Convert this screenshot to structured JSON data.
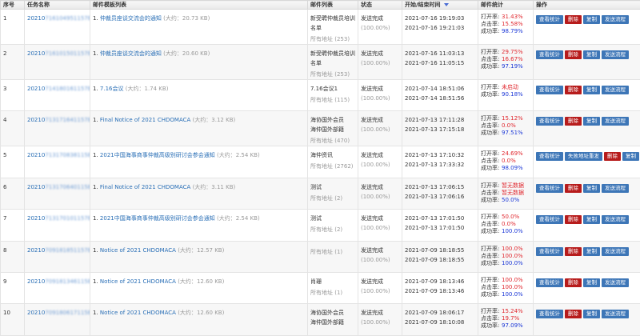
{
  "headers": {
    "seq": "序号",
    "task": "任务名称",
    "template": "邮件模板列表",
    "list": "邮件列表",
    "status": "状态",
    "time": "开始/结束时间",
    "stats": "邮件统计",
    "ops": "操作"
  },
  "labels": {
    "size_prefix": "(大约：",
    "size_suffix": ")",
    "open_rate": "打开率:",
    "click_rate": "点击率:",
    "success_rate": "成功率:",
    "all_addr": "所有地址",
    "btn_stats": "查看统计",
    "btn_delete": "删除",
    "btn_copy": "复制",
    "btn_flow": "发送流程",
    "btn_resend": "失败地址重发"
  },
  "rows": [
    {
      "seq": "1",
      "task_prefix": "20210",
      "task_tail": "716104951157B45",
      "tpl_no": "1.",
      "tpl_name": "仲裁员座谈交流会的通知",
      "size": "20.73 KB",
      "list_name": "新受聘仲裁员培训名单",
      "list_count": "(253)",
      "status": "发送完成",
      "status_pct": "(100.00%)",
      "start": "2021-07-16 19:19:03",
      "end": "2021-07-16 19:21:03",
      "open": "31.43%",
      "click": "15.58%",
      "success": "98.79%",
      "resend": false
    },
    {
      "seq": "2",
      "task_prefix": "20210",
      "task_tail": "716101501157B46",
      "tpl_no": "1.",
      "tpl_name": "仲裁员座谈交流会的通知",
      "size": "20.60 KB",
      "list_name": "新受聘仲裁员培训名单",
      "list_count": "(253)",
      "status": "发送完成",
      "status_pct": "(100.00%)",
      "start": "2021-07-16 11:03:13",
      "end": "2021-07-16 11:05:15",
      "open": "29.75%",
      "click": "16.67%",
      "success": "97.19%",
      "resend": false
    },
    {
      "seq": "3",
      "task_prefix": "20210",
      "task_tail": "714180161157B46",
      "tpl_no": "1.",
      "tpl_name": "7.16会议",
      "size": "1.74 KB",
      "list_name": "7.16会议1",
      "list_count": "(115)",
      "status": "发送完成",
      "status_pct": "(100.00%)",
      "start": "2021-07-14 18:51:06",
      "end": "2021-07-14 18:51:56",
      "open": "未启动",
      "click": "",
      "success": "90.18%",
      "resend": false
    },
    {
      "seq": "4",
      "task_prefix": "20210",
      "task_tail": "713171641157B46",
      "tpl_no": "1.",
      "tpl_name": "Final Notice of 2021 CHDOMACA",
      "size": "3.12 KB",
      "list_name": "海协国外会员\n海仲国外部籍",
      "list_count": "(470)",
      "status": "发送完成",
      "status_pct": "(100.00%)",
      "start": "2021-07-13 17:11:28",
      "end": "2021-07-13 17:15:18",
      "open": "15.12%",
      "click": "0.0%",
      "success": "97.51%",
      "resend": false
    },
    {
      "seq": "5",
      "task_prefix": "20210",
      "task_tail": "713170838115B71",
      "tpl_no": "1.",
      "tpl_name": "2021中国海事商事仲裁高级别研讨会参会通知",
      "size": "2.54 KB",
      "list_name": "海仲资讯",
      "list_count": "(2762)",
      "status": "发送完成",
      "status_pct": "(100.00%)",
      "start": "2021-07-13 17:10:32",
      "end": "2021-07-13 17:33:32",
      "open": "24.69%",
      "click": "0.0%",
      "success": "98.09%",
      "resend": true
    },
    {
      "seq": "6",
      "task_prefix": "20210",
      "task_tail": "713170640115B46",
      "tpl_no": "1.",
      "tpl_name": "Final Notice of 2021 CHDOMACA",
      "size": "3.11 KB",
      "list_name": "测试",
      "list_count": "(2)",
      "status": "发送完成",
      "status_pct": "(100.00%)",
      "start": "2021-07-13 17:06:15",
      "end": "2021-07-13 17:06:16",
      "open": "暂无数据",
      "click": "暂无数据",
      "success": "50.0%",
      "resend": false
    },
    {
      "seq": "7",
      "task_prefix": "20210",
      "task_tail": "713170101157B46",
      "tpl_no": "1.",
      "tpl_name": "2021中国海事商事仲裁高级别研讨会参会通知",
      "size": "2.54 KB",
      "list_name": "测试",
      "list_count": "(2)",
      "status": "发送完成",
      "status_pct": "(100.00%)",
      "start": "2021-07-13 17:01:50",
      "end": "2021-07-13 17:01:50",
      "open": "50.0%",
      "click": "0.0%",
      "success": "100.0%",
      "resend": false
    },
    {
      "seq": "8",
      "task_prefix": "20210",
      "task_tail": "709181851157B46",
      "tpl_no": "1.",
      "tpl_name": "Notice of 2021 CHDOMACA",
      "size": "12.57 KB",
      "list_name": "",
      "list_count": "(1)",
      "status": "发送完成",
      "status_pct": "(100.00%)",
      "start": "2021-07-09 18:18:55",
      "end": "2021-07-09 18:18:55",
      "open": "100.0%",
      "click": "100.0%",
      "success": "100.0%",
      "resend": false
    },
    {
      "seq": "9",
      "task_prefix": "20210",
      "task_tail": "709181346115B46",
      "tpl_no": "1.",
      "tpl_name": "Notice of 2021 CHDOMACA",
      "size": "12.60 KB",
      "list_name": "肖珊",
      "list_count": "(1)",
      "status": "发送完成",
      "status_pct": "(100.00%)",
      "start": "2021-07-09 18:13:46",
      "end": "2021-07-09 18:13:46",
      "open": "100.0%",
      "click": "100.0%",
      "success": "100.0%",
      "resend": false
    },
    {
      "seq": "10",
      "task_prefix": "20210",
      "task_tail": "709180617115B46",
      "tpl_no": "1.",
      "tpl_name": "Notice of 2021 CHDOMACA",
      "size": "12.60 KB",
      "list_name": "海协国外会员\n海仲国外部籍",
      "list_count": "",
      "status": "发送完成",
      "status_pct": "(100.00%)",
      "start": "2021-07-09 18:06:17",
      "end": "2021-07-09 18:10:08",
      "open": "15.24%",
      "click": "19.7%",
      "success": "97.09%",
      "resend": false
    }
  ]
}
